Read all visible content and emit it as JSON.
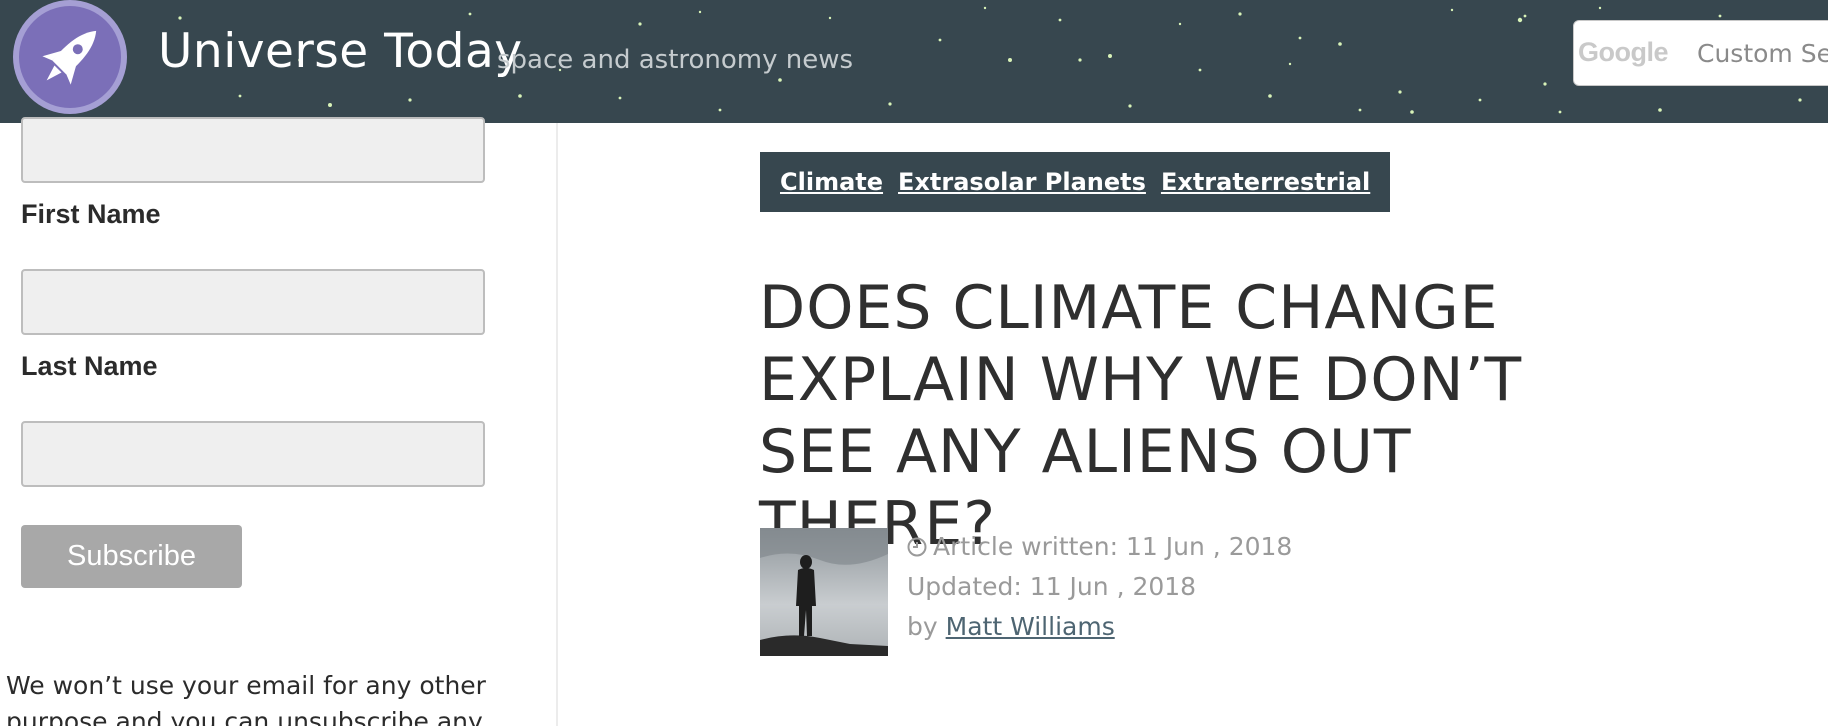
{
  "header": {
    "site_title": "Universe Today",
    "tagline": "space and astronomy news",
    "logo_icon": "rocket-icon",
    "search": {
      "brand": "Google",
      "placeholder": "Custom Sea"
    },
    "colors": {
      "background": "#37474f",
      "logo_badge": "#7b6fb8"
    }
  },
  "sidebar": {
    "form": {
      "first_name_label": "First Name",
      "last_name_label": "Last Name",
      "subscribe_label": "Subscribe"
    },
    "privacy_text": "We won’t use your email for any other purpose and you can unsubscribe any"
  },
  "article": {
    "tags": [
      "Climate",
      "Extrasolar Planets",
      "Extraterrestrial"
    ],
    "title": "DOES CLIMATE CHANGE EXPLAIN WHY WE DON’T SEE ANY ALIENS OUT THERE?",
    "meta": {
      "written_label": "Article written:",
      "written_date": "11 Jun , 2018",
      "updated_label": "Updated:",
      "updated_date": "11 Jun , 2018",
      "by_label": "by",
      "author": "Matt Williams"
    },
    "colors": {
      "tag_bar": "#37474f",
      "author_link": "#4e6572"
    }
  }
}
